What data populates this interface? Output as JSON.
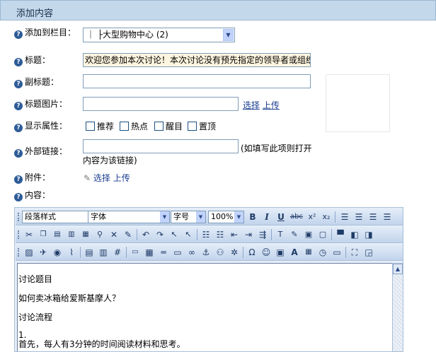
{
  "header": {
    "title": "添加内容"
  },
  "form": {
    "column": {
      "label": "添加到栏目：",
      "value": "｜ ├大型购物中心 (2)"
    },
    "title": {
      "label": "标题：",
      "value": "欢迎您参加本次讨论！本次讨论没有预先指定的领导者或组织"
    },
    "subtitle": {
      "label": "副标题：",
      "value": ""
    },
    "title_image": {
      "label": "标题图片：",
      "value": "",
      "select_link": "选择",
      "upload_link": "上传"
    },
    "display_attr": {
      "label": "显示属性：",
      "options": [
        "推荐",
        "热点",
        "醒目",
        "置顶"
      ]
    },
    "external_link": {
      "label": "外部链接：",
      "value": "",
      "hint_line1": "(如填写此项则打开",
      "hint_line2": "内容为该链接)"
    },
    "attachment": {
      "label": "附件：",
      "select_link": "选择",
      "upload_link": "上传"
    },
    "content": {
      "label": "内容："
    }
  },
  "editor": {
    "paragraph_style": "段落样式",
    "font": "字体",
    "font_size": "字号",
    "zoom": "100%",
    "body_lines": [
      "讨论题目",
      "如何卖冰箱给爱斯基摩人？",
      "讨论流程",
      "1.",
      "首先，每人有3分钟的时间阅读材料和思考。"
    ]
  }
}
